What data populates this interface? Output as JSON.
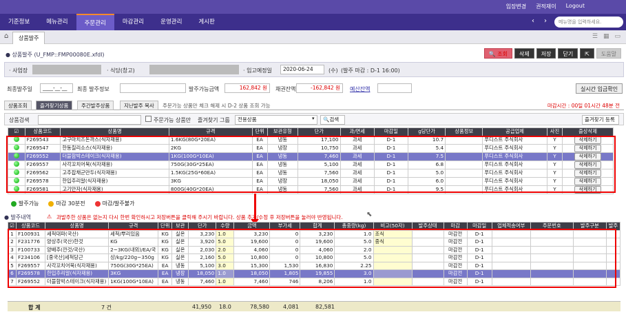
{
  "topbar": {
    "left": "",
    "actions": [
      "입장변경",
      "권적재이",
      "Logout"
    ]
  },
  "menu": [
    "기준정보",
    "메뉴관리",
    "주문관리",
    "마감관리",
    "운영관리",
    "게시판"
  ],
  "menu_active": 2,
  "menu_search_placeholder": "메뉴명을 입력하세요.",
  "tab": {
    "current": "상품발주"
  },
  "page": {
    "title": "상품발주 (U_FMP::FMP00080E.xfdl)",
    "buttons": [
      "조회",
      "삭제",
      "저장",
      "닫기",
      "도움말"
    ]
  },
  "cond": {
    "business_label": "사업장",
    "restaurant_label": "식당(창고)",
    "date_label": "입고예정일",
    "date": "2020-06-24",
    "weekday": "(수)",
    "deadline": "(발주 마감 : D-1 16:00)"
  },
  "row2": {
    "final_amount_label": "최종발주일",
    "final_amount_value": "____-__-__",
    "final_info_label": "최종 발주정보",
    "available_label": "발주가능금액",
    "available_value": "162,842 원",
    "balance_label": "채권잔액",
    "balance_value": "-162,842 원",
    "prepaid_link": "예산잔액",
    "realtime_btn": "실시간 입금확인"
  },
  "subtabs": [
    "상품조회",
    "즐겨찾기상품",
    "주간발주상품",
    "지난발주 복사"
  ],
  "subtab_note": "주문가능 상품만 체크 해제 시 D-2 상품 조회 가능",
  "deadline_notice": "마감시간 : 00일 01시간 48분 전",
  "filter": {
    "search_label": "상품검색",
    "orderable_label": "주문가능 상품만",
    "group_label": "즐겨찾기 그룹",
    "group_value": "전용상품",
    "search_btn": "검색",
    "fav_btn": "즐겨찾기 등록"
  },
  "t1": {
    "headers": [
      "",
      "상품코드",
      "상품명",
      "규격",
      "단위",
      "보관유형",
      "단가",
      "과/면세",
      "마감일",
      "g당단가",
      "상품정보",
      "공급업체",
      "사진",
      "즐상삭제"
    ],
    "rows": [
      [
        "F269543",
        "고구마치즈돈까스(식자재용)",
        "1.6KG(80G*20EA)",
        "EA",
        "냉동",
        "17,100",
        "과세",
        "D-1",
        "10.7",
        "",
        "푸디스트 주식회사",
        "Y",
        "삭제하기"
      ],
      [
        "F269547",
        "한동칠리소스(식자재용)",
        "2KG",
        "EA",
        "냉장",
        "10,750",
        "과세",
        "D-1",
        "5.4",
        "",
        "푸디스트 주식회사",
        "Y",
        "삭제하기"
      ],
      [
        "F269552",
        "더블함박스테이크(식자재용)",
        "1KG(100G*10EA)",
        "EA",
        "냉동",
        "7,460",
        "과세",
        "D-1",
        "7.5",
        "",
        "푸디스트 주식회사",
        "Y",
        "삭제하기"
      ],
      [
        "F269557",
        "사각꼬치어묵(식자재용)",
        "750G(30G*25EA)",
        "EA",
        "냉동",
        "5,100",
        "과세",
        "D-1",
        "6.8",
        "",
        "푸디스트 주식회사",
        "Y",
        "삭제하기"
      ],
      [
        "F269562",
        "고추잡채군만두(식자재용)",
        "1.5KG(25G*60EA)",
        "EA",
        "냉동",
        "7,560",
        "과세",
        "D-1",
        "5.0",
        "",
        "푸디스트 주식회사",
        "Y",
        "삭제하기"
      ],
      [
        "F269578",
        "한입추리알(식자재용)",
        "3KG",
        "EA",
        "냉장",
        "18,050",
        "과세",
        "D-1",
        "6.0",
        "",
        "푸디스트 주식회사",
        "Y",
        "삭제하기"
      ],
      [
        "F269581",
        "고기만자(식자재용)",
        "800G(40G*20EA)",
        "EA",
        "냉동",
        "7,560",
        "과세",
        "D-1",
        "9.5",
        "",
        "푸디스트 주식회사",
        "Y",
        "삭제하기"
      ]
    ]
  },
  "legend": [
    "발주가능",
    "마감 30분전",
    "마감/발주불가"
  ],
  "sec2": {
    "title": "발주내역",
    "warn": "과발주한 상품은 없는지 다시 한번 확인하시고 저장버튼을 클릭해 주시기 바랍니다. 상품 추가/수정 후 저장버튼을 눌러야 반영됩니다."
  },
  "t2": {
    "headers": [
      "",
      "상품코드",
      "상품명",
      "규격",
      "단위",
      "보관",
      "단가",
      "수량",
      "금액",
      "부가세",
      "합계",
      "총중량(kg)",
      "비고(50자)",
      "발주상태",
      "마감",
      "마감일",
      "업체적송여부",
      "주문번호",
      "발주구분",
      "발주"
    ],
    "rows": [
      [
        "1",
        "F100931",
        "세척대파(국산)",
        "세척/뿌리있음",
        "KG",
        "실온",
        "3,230",
        "1.0",
        "3,230",
        "0",
        "3,230",
        "1.0",
        "조식",
        "",
        "마감전",
        "D-1",
        "",
        "",
        "",
        ""
      ],
      [
        "2",
        "F231776",
        "양상추(국산)한것",
        "KG",
        "KG",
        "실온",
        "3,920",
        "5.0",
        "19,600",
        "0",
        "19,600",
        "5.0",
        "중식",
        "",
        "마감전",
        "D-1",
        "",
        "",
        "",
        ""
      ],
      [
        "3",
        "F100733",
        "양배추(깐것/국산)",
        "2~3KG(내외)/EA/국",
        "KG",
        "실온",
        "2,030",
        "2.0",
        "4,060",
        "0",
        "4,060",
        "2.0",
        "",
        "",
        "마감전",
        "D-1",
        "",
        "",
        "",
        ""
      ],
      [
        "4",
        "F234106",
        "[중국산]세척당근",
        "상/kg/220g~350g",
        "KG",
        "실온",
        "2,160",
        "5.0",
        "10,800",
        "0",
        "10,800",
        "5.0",
        "",
        "",
        "마감전",
        "D-1",
        "",
        "",
        "",
        ""
      ],
      [
        "5",
        "F269557",
        "사각꼬치어묵(식자재용)",
        "750G(30G*25EA)",
        "EA",
        "냉동",
        "5,100",
        "3.0",
        "15,300",
        "1,530",
        "16,830",
        "2.25",
        "",
        "",
        "마감전",
        "D-1",
        "",
        "",
        "",
        ""
      ],
      [
        "6",
        "F269578",
        "한입추리알(식자재용)",
        "3KG",
        "EA",
        "냉장",
        "18,050",
        "1.0",
        "18,050",
        "1,805",
        "19,855",
        "3.0",
        "",
        "",
        "마감전",
        "D-1",
        "",
        "",
        "",
        ""
      ],
      [
        "7",
        "F269552",
        "더블함박스테이크(식자재용)",
        "1KG(100G*10EA)",
        "EA",
        "냉동",
        "7,460",
        "1.0",
        "7,460",
        "746",
        "8,206",
        "1.0",
        "",
        "",
        "마감전",
        "D-1",
        "",
        "",
        "",
        ""
      ]
    ]
  },
  "sum": {
    "label": "합 계",
    "count": "7 건",
    "price": "41,950",
    "qty": "18.0",
    "amount": "78,580",
    "vat": "4,081",
    "total": "82,581"
  }
}
